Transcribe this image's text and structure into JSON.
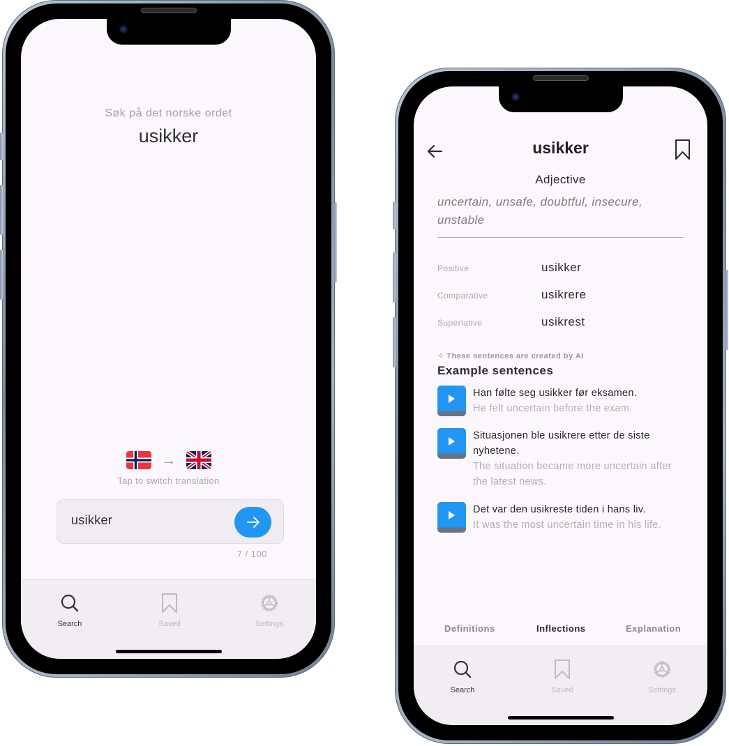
{
  "search_screen": {
    "prompt": "Søk på det norske ordet",
    "word": "usikker",
    "from_flag": "norway-flag",
    "to_flag": "uk-flag",
    "switch_icon": "arrow-right-icon",
    "switch_hint": "Tap to switch translation",
    "input_value": "usikker",
    "input_placeholder": "",
    "submit_icon": "arrow-right-icon",
    "counter": "7 / 100"
  },
  "tabbar": {
    "items": [
      {
        "label": "Search",
        "icon": "search-icon",
        "active": true
      },
      {
        "label": "Saved",
        "icon": "bookmark-icon",
        "active": false
      },
      {
        "label": "Settings",
        "icon": "gear-icon",
        "active": false
      }
    ]
  },
  "detail_screen": {
    "title": "usikker",
    "back_icon": "arrow-left-icon",
    "bookmark_icon": "bookmark-icon",
    "part_of_speech": "Adjective",
    "translations": "uncertain, unsafe, doubtful, insecure, unstable",
    "inflections": [
      {
        "label": "Positive",
        "value": "usikker"
      },
      {
        "label": "Comparative",
        "value": "usikrere"
      },
      {
        "label": "Superlative",
        "value": "usikrest"
      }
    ],
    "ai_note": "These sentences are created by AI",
    "ai_icon": "sparkle-icon",
    "examples_title": "Example sentences",
    "examples": [
      {
        "norwegian": "Han følte seg usikker før eksamen.",
        "english": "He felt uncertain before the exam."
      },
      {
        "norwegian": "Situasjonen ble usikrere etter de siste nyhetene.",
        "english": "The situation became more uncertain after the latest news."
      },
      {
        "norwegian": "Det var den usikreste tiden i hans liv.",
        "english": "It was the most uncertain time in his life."
      }
    ],
    "section_tabs": [
      {
        "label": "Definitions",
        "active": false
      },
      {
        "label": "Inflections",
        "active": true
      },
      {
        "label": "Explanation",
        "active": false
      }
    ]
  },
  "colors": {
    "accent": "#2196f3",
    "screen_bg": "#fcf7fd",
    "tabbar_bg": "#f2ecf3"
  }
}
